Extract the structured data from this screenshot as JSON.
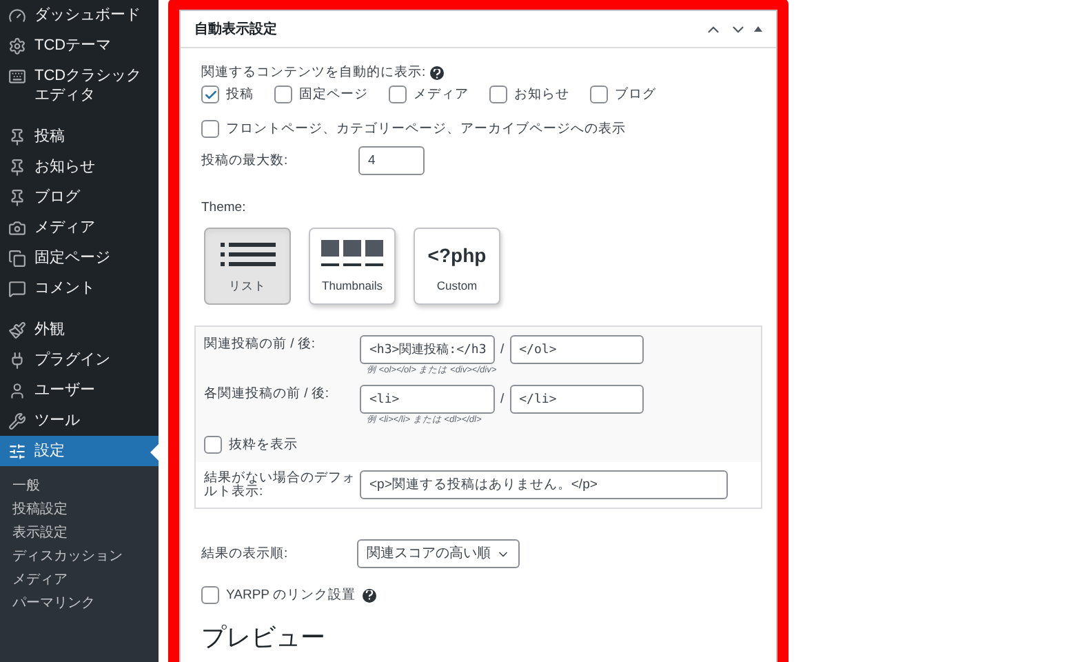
{
  "sidebar": {
    "items": [
      {
        "label": "ダッシュボード",
        "selected": false
      },
      {
        "label": "TCDテーマ",
        "selected": false
      },
      {
        "label": "TCDクラシックエディタ",
        "selected": false
      },
      {
        "label": "投稿",
        "selected": false
      },
      {
        "label": "お知らせ",
        "selected": false
      },
      {
        "label": "ブログ",
        "selected": false
      },
      {
        "label": "メディア",
        "selected": false
      },
      {
        "label": "固定ページ",
        "selected": false
      },
      {
        "label": "コメント",
        "selected": false
      },
      {
        "label": "外観",
        "selected": false
      },
      {
        "label": "プラグイン",
        "selected": false
      },
      {
        "label": "ユーザー",
        "selected": false
      },
      {
        "label": "ツール",
        "selected": false
      },
      {
        "label": "設定",
        "selected": true
      }
    ],
    "submenu": [
      "一般",
      "投稿設定",
      "表示設定",
      "ディスカッション",
      "メディア",
      "パーマリンク"
    ]
  },
  "panel": {
    "title": "自動表示設定",
    "content_label": "関連するコンテンツを自動的に表示:",
    "content_types": [
      {
        "label": "投稿",
        "checked": true
      },
      {
        "label": "固定ページ",
        "checked": false
      },
      {
        "label": "メディア",
        "checked": false
      },
      {
        "label": "お知らせ",
        "checked": false
      },
      {
        "label": "ブログ",
        "checked": false
      }
    ],
    "archive_option": {
      "label": "フロントページ、カテゴリーページ、アーカイブページへの表示",
      "checked": false
    },
    "max_posts": {
      "label": "投稿の最大数:",
      "value": "4"
    },
    "theme_label": "Theme:",
    "themes": [
      {
        "kind": "list",
        "label": "リスト",
        "selected": true
      },
      {
        "kind": "thumbnails",
        "label": "Thumbnails",
        "selected": false
      },
      {
        "kind": "custom",
        "label": "Custom",
        "icon_text": "<?php",
        "selected": false
      }
    ],
    "custom": {
      "rows": [
        {
          "label": "関連投稿の前 / 後:",
          "before": "<h3>関連投稿:</h3",
          "separator": "/",
          "after": "</ol>",
          "hint": "例 <ol></ol> または <div></div>"
        },
        {
          "label": "各関連投稿の前 / 後:",
          "before": "<li>",
          "separator": "/",
          "after": "</li>",
          "hint": "例 <li></li> または <dl></dl>"
        }
      ],
      "excerpt": {
        "label": "抜粋を表示",
        "checked": false
      },
      "default_display": {
        "label": "結果がない場合のデフォルト表示:",
        "value": "<p>関連する投稿はありません。</p>"
      }
    },
    "order": {
      "label": "結果の表示順:",
      "value": "関連スコアの高い順"
    },
    "link_option": {
      "label": "YARPP のリンク設置",
      "checked": false
    },
    "preview_heading": "プレビュー"
  }
}
